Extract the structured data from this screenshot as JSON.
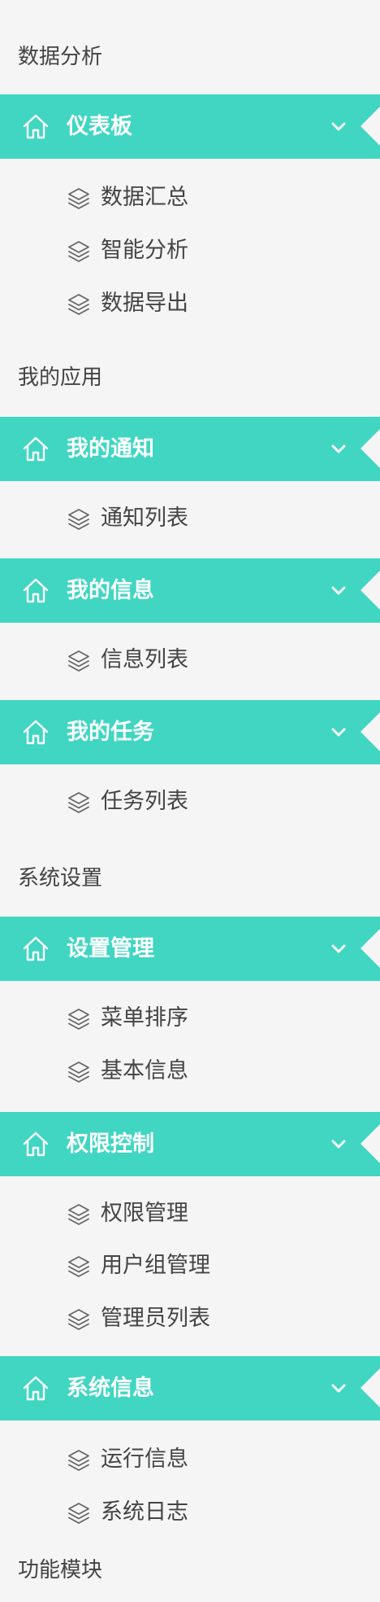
{
  "colors": {
    "accent": "#40d6c2",
    "background": "#f5f5f6",
    "text": "#444444",
    "bar_text": "#ffffff"
  },
  "icons": {
    "bar": "home-icon",
    "bar_toggle": "chevron-down-icon",
    "sub_item": "layers-icon"
  },
  "sidebar": {
    "sections": [
      {
        "label": "数据分析",
        "groups": [
          {
            "title": "仪表板",
            "items": [
              "数据汇总",
              "智能分析",
              "数据导出"
            ]
          }
        ]
      },
      {
        "label": "我的应用",
        "groups": [
          {
            "title": "我的通知",
            "items": [
              "通知列表"
            ]
          },
          {
            "title": "我的信息",
            "items": [
              "信息列表"
            ]
          },
          {
            "title": "我的任务",
            "items": [
              "任务列表"
            ]
          }
        ]
      },
      {
        "label": "系统设置",
        "groups": [
          {
            "title": "设置管理",
            "items": [
              "菜单排序",
              "基本信息"
            ]
          },
          {
            "title": "权限控制",
            "items": [
              "权限管理",
              "用户组管理",
              "管理员列表"
            ]
          },
          {
            "title": "系统信息",
            "items": [
              "运行信息",
              "系统日志"
            ]
          }
        ]
      },
      {
        "label": "功能模块",
        "groups": []
      }
    ]
  }
}
